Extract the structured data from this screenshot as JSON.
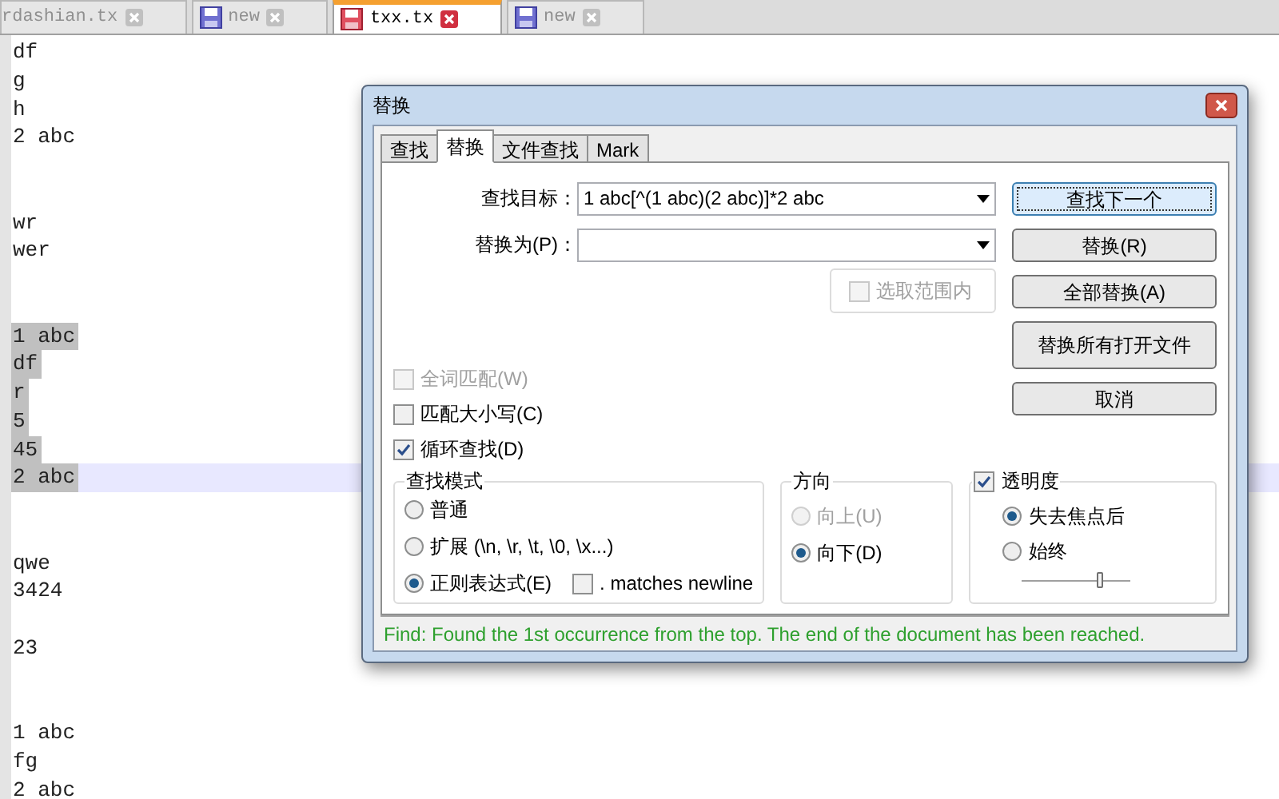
{
  "editor": {
    "tabs": [
      {
        "kind": "clipped",
        "label": "rdashian.tx",
        "selected": false
      },
      {
        "kind": "full",
        "label": "new",
        "modified": false,
        "selected": false
      },
      {
        "kind": "full",
        "label": "txx.tx",
        "modified": true,
        "selected": true
      },
      {
        "kind": "full",
        "label": "new",
        "modified": false,
        "selected": false
      }
    ],
    "lines": [
      {
        "kind": "text",
        "text": "df",
        "selected": false,
        "current": false
      },
      {
        "kind": "text",
        "text": "g",
        "selected": false,
        "current": false
      },
      {
        "kind": "text",
        "text": "h",
        "selected": false,
        "current": false
      },
      {
        "kind": "text",
        "text": "2 abc",
        "selected": false,
        "current": false
      },
      {
        "kind": "blank"
      },
      {
        "kind": "blank"
      },
      {
        "kind": "text",
        "text": "wr",
        "selected": false,
        "current": false
      },
      {
        "kind": "text",
        "text": "wer",
        "selected": false,
        "current": false
      },
      {
        "kind": "blank"
      },
      {
        "kind": "blank"
      },
      {
        "kind": "text",
        "text": "1 abc",
        "selected": true,
        "current": false
      },
      {
        "kind": "text",
        "text": "df",
        "selected": true,
        "current": false
      },
      {
        "kind": "text",
        "text": "r",
        "selected": true,
        "current": false
      },
      {
        "kind": "text",
        "text": "5",
        "selected": true,
        "current": false
      },
      {
        "kind": "text",
        "text": "45",
        "selected": true,
        "current": false
      },
      {
        "kind": "text",
        "text": "2 abc",
        "selected": true,
        "current": true
      },
      {
        "kind": "blank"
      },
      {
        "kind": "blank"
      },
      {
        "kind": "text",
        "text": "qwe",
        "selected": false,
        "current": false
      },
      {
        "kind": "text",
        "text": "3424",
        "selected": false,
        "current": false
      },
      {
        "kind": "blank"
      },
      {
        "kind": "text",
        "text": "23",
        "selected": false,
        "current": false
      },
      {
        "kind": "blank"
      },
      {
        "kind": "blank"
      },
      {
        "kind": "text",
        "text": "1 abc",
        "selected": false,
        "current": false
      },
      {
        "kind": "text",
        "text": "fg",
        "selected": false,
        "current": false
      },
      {
        "kind": "text",
        "text": "2 abc",
        "selected": false,
        "current": false
      }
    ]
  },
  "dialog": {
    "title": "替换",
    "tabs": [
      {
        "label": "查找",
        "selected": false
      },
      {
        "label": "替换",
        "selected": true
      },
      {
        "label": "文件查找",
        "selected": false
      },
      {
        "label": "Mark",
        "selected": false
      }
    ],
    "find_what": {
      "label": "查找目标：",
      "value": "1 abc[^(1 abc)(2 abc)]*2 abc"
    },
    "replace_with": {
      "label": "替换为(P)："
    },
    "in_selection": {
      "label": "选取范围内",
      "checked": false,
      "disabled": true
    },
    "buttons": [
      {
        "label": "查找下一个",
        "focused": true
      },
      {
        "label": "替换(R)",
        "focused": false
      },
      {
        "label": "全部替换(A)",
        "focused": false
      },
      {
        "label": "替换所有打开文件",
        "focused": false
      },
      {
        "label": "取消",
        "focused": false
      }
    ],
    "options": [
      {
        "label": "全词匹配(W)",
        "checked": false,
        "disabled": true
      },
      {
        "label": "匹配大小写(C)",
        "checked": false,
        "disabled": false
      },
      {
        "label": "循环查找(D)",
        "checked": true,
        "disabled": false
      }
    ],
    "search_mode": {
      "title": "查找模式",
      "options": [
        {
          "label": "普通",
          "selected": false
        },
        {
          "label": "扩展 (\\n, \\r, \\t, \\0, \\x...)",
          "selected": false
        },
        {
          "label": "正则表达式(E)",
          "selected": true
        }
      ],
      "dot_matches_newline": {
        "label": ". matches newline",
        "checked": false
      }
    },
    "direction": {
      "title": "方向",
      "options": [
        {
          "label": "向上(U)",
          "selected": false,
          "disabled": true
        },
        {
          "label": "向下(D)",
          "selected": true,
          "disabled": false
        }
      ]
    },
    "transparency": {
      "label": "透明度",
      "checked": true,
      "options": [
        {
          "label": "失去焦点后",
          "selected": true
        },
        {
          "label": "始终",
          "selected": false
        }
      ],
      "slider": {
        "level": 0.72
      }
    },
    "status": "Find: Found the 1st occurrence from the top. The end of the document has been reached."
  }
}
